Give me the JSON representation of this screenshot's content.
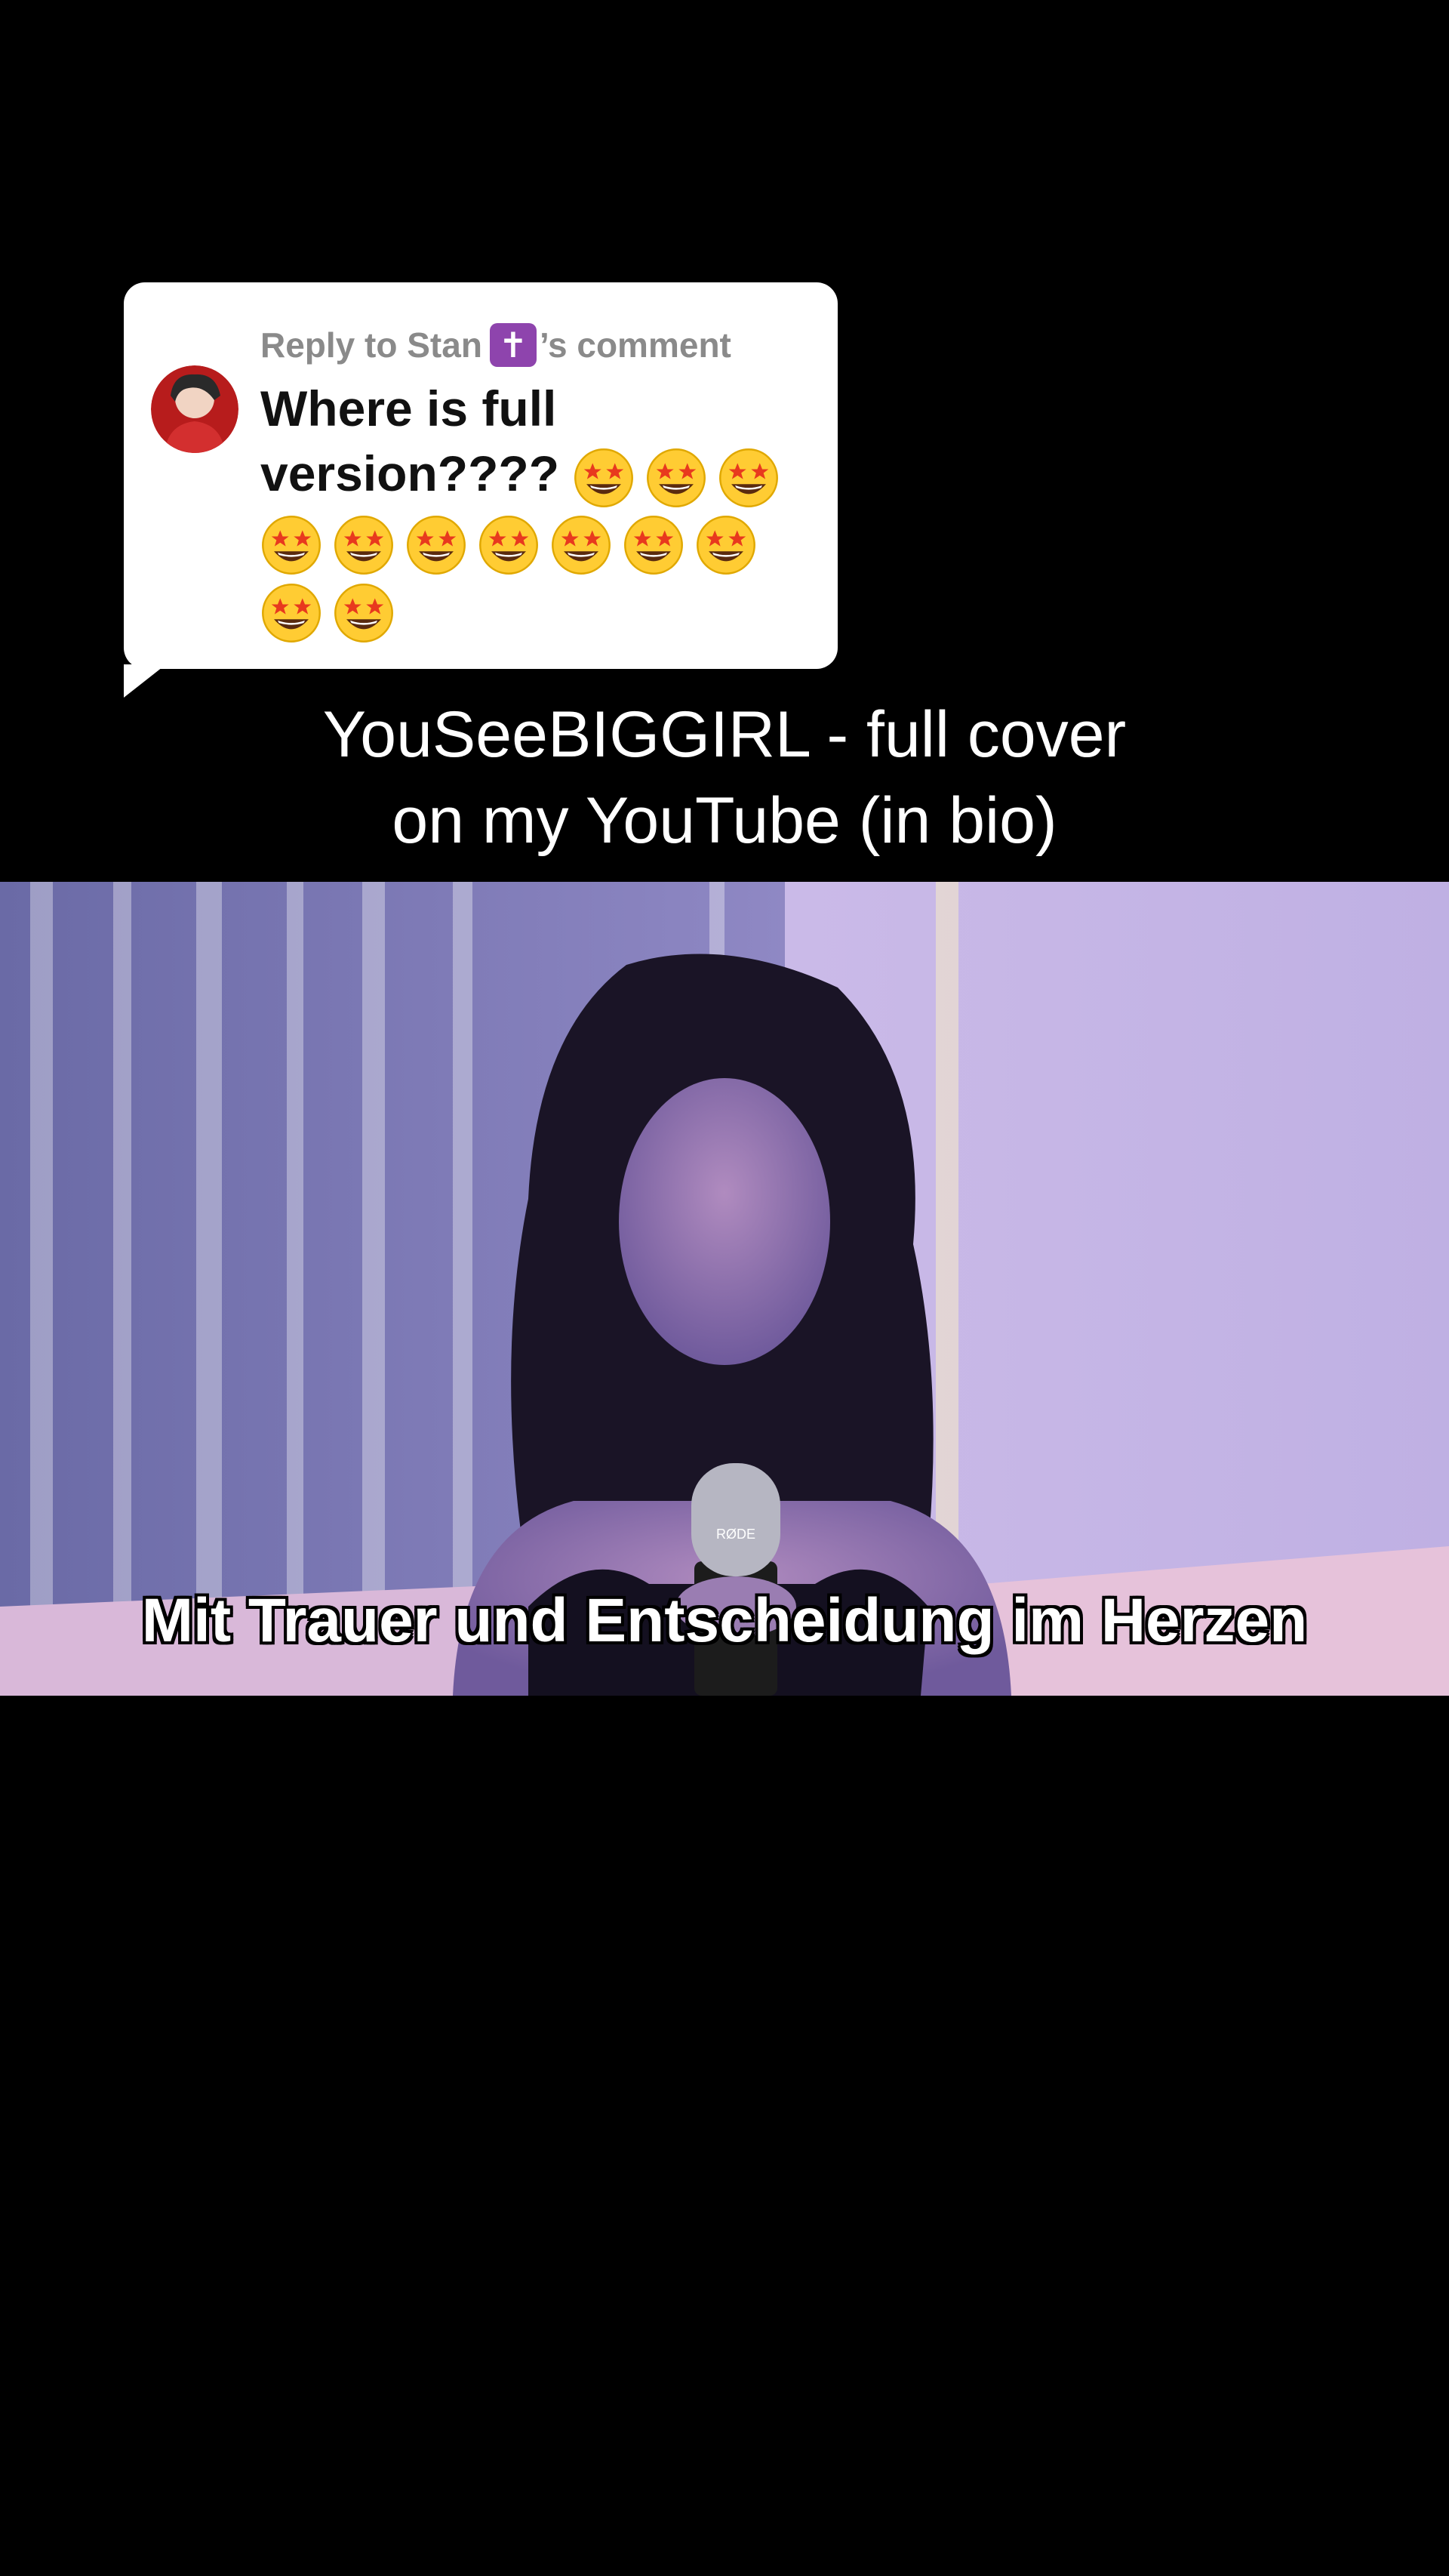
{
  "comment_bubble": {
    "reply_prefix": "Reply to Stan",
    "reply_badge_symbol": "✝",
    "reply_suffix": "’s comment",
    "comment_text_line1": "Where is full",
    "comment_text_line2": "version????",
    "emoji_name": "star-struck-emoji",
    "emoji_count_line2": 3,
    "emoji_count_line3": 7,
    "emoji_count_line4": 2
  },
  "caption": {
    "line1": "YouSeeBIGGIRL - full cover",
    "line2": "on my YouTube (in bio)"
  },
  "video": {
    "subtitle": "Mit Trauer und Entscheidung im Herzen",
    "mic_brand": "RØDE"
  },
  "colors": {
    "background": "#000000",
    "bubble": "#ffffff",
    "reply_text": "#8a8a8a",
    "badge": "#8e44ad"
  }
}
